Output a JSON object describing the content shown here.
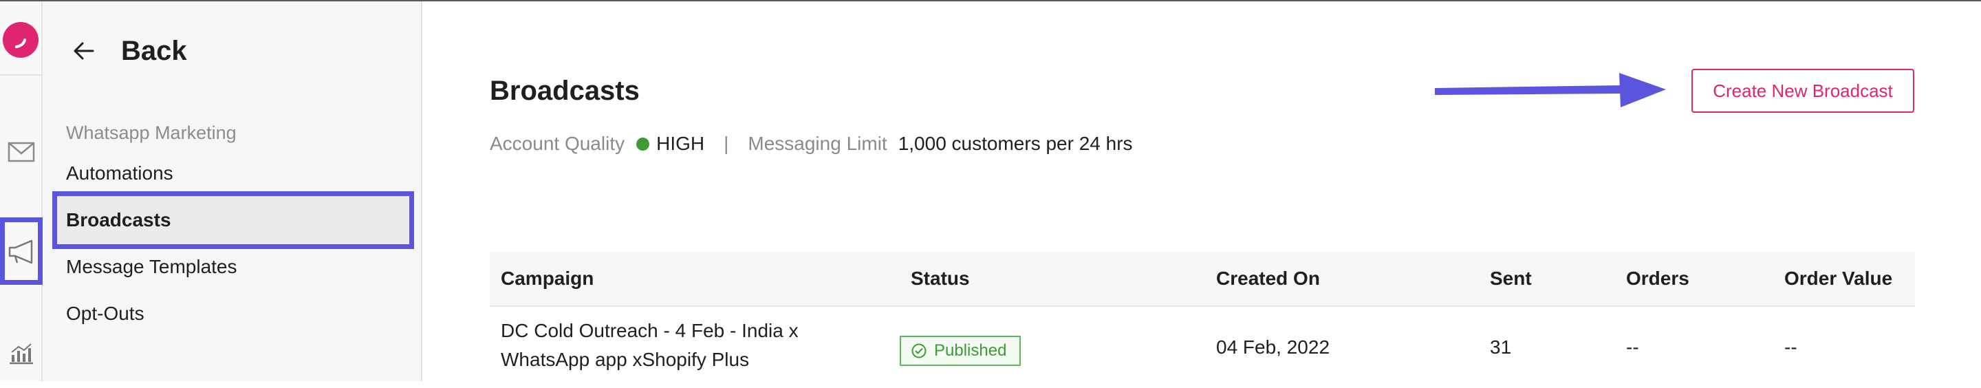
{
  "sidebar": {
    "back_label": "Back",
    "section_title": "Whatsapp Marketing",
    "items": [
      {
        "label": "Automations"
      },
      {
        "label": "Broadcasts"
      },
      {
        "label": "Message Templates"
      },
      {
        "label": "Opt-Outs"
      }
    ]
  },
  "main": {
    "title": "Broadcasts",
    "create_button": "Create New Broadcast",
    "account_quality_label": "Account Quality",
    "account_quality_value": "HIGH",
    "separator": "|",
    "messaging_limit_label": "Messaging Limit",
    "messaging_limit_value": "1,000 customers per 24 hrs"
  },
  "table": {
    "headers": [
      "Campaign",
      "Status",
      "Created On",
      "Sent",
      "Orders",
      "Order Value"
    ],
    "rows": [
      {
        "campaign": "DC Cold Outreach - 4 Feb - India x WhatsApp app xShopify Plus",
        "status": "Published",
        "created_on": "04 Feb, 2022",
        "sent": "31",
        "orders": "--",
        "order_value": "--"
      }
    ]
  },
  "icons": {
    "rail": [
      "app-logo-icon",
      "mail-icon",
      "megaphone-icon",
      "analytics-icon"
    ],
    "back": "arrow-left-icon",
    "status": "check-circle-icon"
  },
  "colors": {
    "brand": "#e0246f",
    "highlight": "#5b55dd",
    "quality_dot": "#3d9a36",
    "published": "#5cb85c"
  }
}
